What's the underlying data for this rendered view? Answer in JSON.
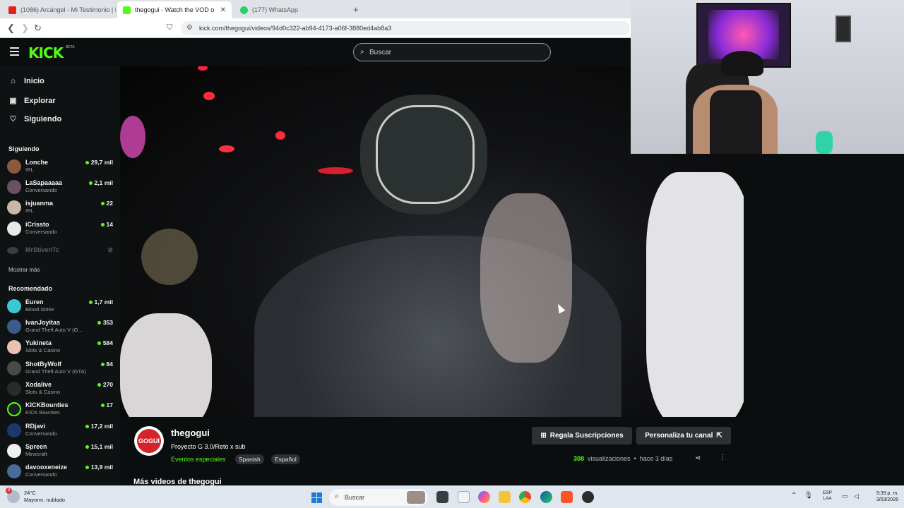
{
  "browser": {
    "tabs": [
      {
        "label": "(1086) Arcángel - Mi Testimonio | Hi",
        "icon": "youtube-icon",
        "color": "#e62117"
      },
      {
        "label": "thegogui - Watch the VOD o",
        "icon": "kick-icon",
        "color": "#53fc18",
        "active": true
      },
      {
        "label": "(177) WhatsApp",
        "icon": "whatsapp-icon",
        "color": "#25d366"
      }
    ],
    "new_tab": "+",
    "url": "kick.com/thegogui/videos/94d0c322-ab94-4173-a06f-3880ed4ab8a3"
  },
  "kick": {
    "logo": "KICK",
    "logo_badge": "BETA",
    "search_placeholder": "Buscar",
    "brand_color": "#53fc18"
  },
  "sidebar": {
    "nav": [
      {
        "label": "Inicio",
        "icon": "home-icon"
      },
      {
        "label": "Explorar",
        "icon": "compass-icon"
      },
      {
        "label": "Siguiendo",
        "icon": "heart-icon"
      }
    ],
    "following_title": "Siguiendo",
    "following": [
      {
        "name": "Lonche",
        "category": "IRL",
        "viewers": "29,7 mil",
        "avatar_color": "#8a5a3c"
      },
      {
        "name": "LaSapaaaaa",
        "category": "Conversando",
        "viewers": "2,1 mil",
        "avatar_color": "#6b4f63"
      },
      {
        "name": "isjuanma",
        "category": "IRL",
        "viewers": "22",
        "avatar_color": "#c9b8a6"
      },
      {
        "name": "iCrissto",
        "category": "Conversando",
        "viewers": "14",
        "avatar_color": "#e9e9e9"
      },
      {
        "name": "MrStivenTc",
        "category": "",
        "viewers": "",
        "offline": true,
        "avatar_color": "#3a3d3f"
      }
    ],
    "show_more": "Mostrar más",
    "recommended_title": "Recomendado",
    "recommended": [
      {
        "name": "Euren",
        "category": "Blood Strike",
        "viewers": "1,7 mil",
        "avatar_color": "#3cc7d6"
      },
      {
        "name": "IvanJoyitas",
        "category": "Grand Theft Auto V (G...",
        "viewers": "353",
        "avatar_color": "#3c5a8a"
      },
      {
        "name": "Yukineta",
        "category": "Slots & Casino",
        "viewers": "584",
        "avatar_color": "#e8c4b0"
      },
      {
        "name": "ShotByWolf",
        "category": "Grand Theft Auto V (GTA)",
        "viewers": "84",
        "avatar_color": "#4a4a4a"
      },
      {
        "name": "Xodalive",
        "category": "Slots & Casino",
        "viewers": "270",
        "avatar_color": "#2b2b2b"
      },
      {
        "name": "KICKBounties",
        "category": "KICK Bounties",
        "viewers": "17",
        "avatar_color": "#53fc18"
      },
      {
        "name": "RDjavi",
        "category": "Conversando",
        "viewers": "17,2 mil",
        "avatar_color": "#1a3a6a"
      },
      {
        "name": "Spreen",
        "category": "Minecraft",
        "viewers": "15,1 mil",
        "avatar_color": "#f0f0f0"
      },
      {
        "name": "davooxeneize",
        "category": "Conversando",
        "viewers": "13,9 mil",
        "avatar_color": "#4a6a9a"
      }
    ]
  },
  "video_info": {
    "channel": "thegogui",
    "avatar_text": "GOGUI",
    "title": "Proyecto G 3.0/Reto x sub",
    "category": "Eventos especiales",
    "tags": [
      "Spanish",
      "Español"
    ],
    "gift_button": "Regala Suscripciones",
    "customize_button": "Personaliza tu canal",
    "views": "308",
    "views_label": "visualizaciones",
    "separator": "•",
    "age": "hace 3 días",
    "more_videos": "Más videos de thegogui"
  },
  "taskbar": {
    "notification_count": "3",
    "temperature": "24°C",
    "weather": "Mayorm. nublado",
    "search_placeholder": "Buscar",
    "language": "ESP",
    "keyboard": "LAA",
    "time": "9:39 p. m.",
    "date": "3/03/2026"
  }
}
